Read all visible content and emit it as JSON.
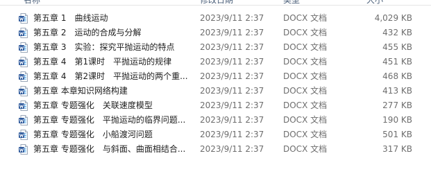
{
  "columns": {
    "name": "名称",
    "date": "修改日期",
    "type": "类型",
    "size": "大小"
  },
  "files": [
    {
      "name": "第五章 1　曲线运动",
      "date": "2023/9/11 2:37",
      "type": "DOCX 文档",
      "size": "4,029 KB",
      "icon": "word-document-icon"
    },
    {
      "name": "第五章 2　运动的合成与分解",
      "date": "2023/9/11 2:37",
      "type": "DOCX 文档",
      "size": "432 KB",
      "icon": "word-document-icon"
    },
    {
      "name": "第五章 3　实验：探究平抛运动的特点",
      "date": "2023/9/11 2:37",
      "type": "DOCX 文档",
      "size": "455 KB",
      "icon": "word-document-icon"
    },
    {
      "name": "第五章 4　第1课时　平抛运动的规律",
      "date": "2023/9/11 2:37",
      "type": "DOCX 文档",
      "size": "451 KB",
      "icon": "word-document-icon"
    },
    {
      "name": "第五章 4　第2课时　平抛运动的两个重...",
      "date": "2023/9/11 2:37",
      "type": "DOCX 文档",
      "size": "468 KB",
      "icon": "word-document-icon"
    },
    {
      "name": "第五章 本章知识网络构建",
      "date": "2023/9/11 2:37",
      "type": "DOCX 文档",
      "size": "413 KB",
      "icon": "word-document-icon"
    },
    {
      "name": "第五章 专题强化　关联速度模型",
      "date": "2023/9/11 2:37",
      "type": "DOCX 文档",
      "size": "277 KB",
      "icon": "word-document-icon"
    },
    {
      "name": "第五章 专题强化　平抛运动的临界问题...",
      "date": "2023/9/11 2:37",
      "type": "DOCX 文档",
      "size": "190 KB",
      "icon": "word-document-icon"
    },
    {
      "name": "第五章 专题强化　小船渡河问题",
      "date": "2023/9/11 2:37",
      "type": "DOCX 文档",
      "size": "501 KB",
      "icon": "word-document-icon"
    },
    {
      "name": "第五章 专题强化　与斜面、曲面相结合...",
      "date": "2023/9/11 2:37",
      "type": "DOCX 文档",
      "size": "317 KB",
      "icon": "word-document-icon"
    }
  ],
  "colors": {
    "word_blue": "#2b579a",
    "word_light": "#41a5ee"
  }
}
